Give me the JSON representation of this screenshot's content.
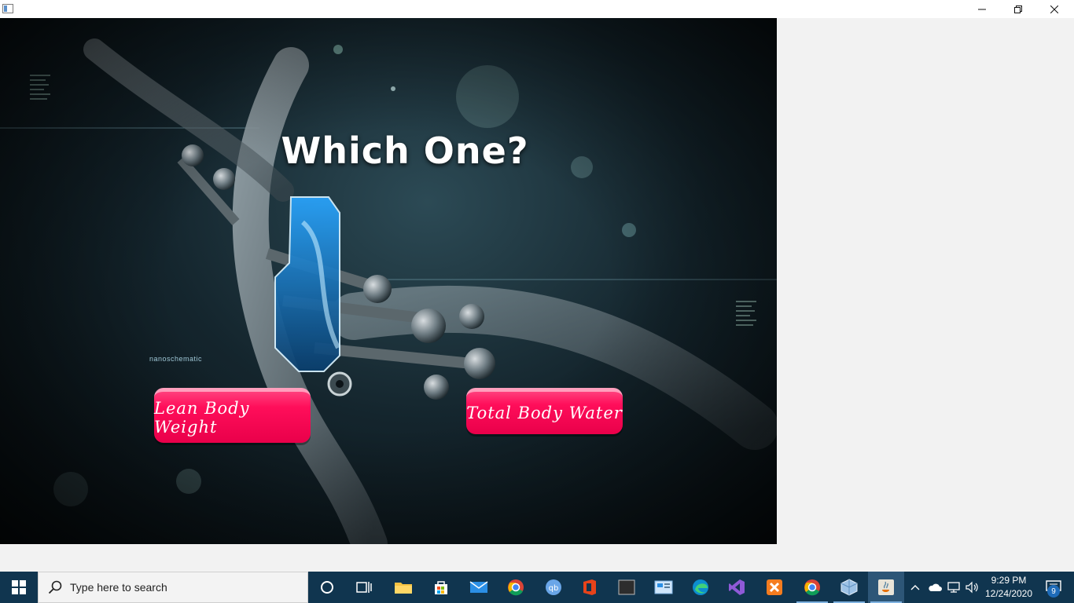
{
  "window": {
    "minimize_label": "",
    "maximize_label": "",
    "close_label": ""
  },
  "screen": {
    "heading": "Which One?",
    "overlay_text": "nanoschematic",
    "options": [
      {
        "label": "Lean Body Weight"
      },
      {
        "label": "Total Body Water"
      }
    ]
  },
  "taskbar": {
    "search_placeholder": "Type here to search",
    "pinned": [
      "task-view-icon",
      "file-explorer-icon",
      "store-icon",
      "mail-icon",
      "chrome-icon",
      "qbittorrent-icon",
      "office-icon",
      "terminal-icon",
      "control-panel-icon",
      "edge-icon",
      "visual-studio-icon",
      "xampp-icon",
      "chrome-icon",
      "virtualbox-icon",
      "java-icon"
    ],
    "time": "9:29 PM",
    "date": "12/24/2020",
    "notification_count": "9"
  },
  "colors": {
    "button_pink": "#ff0e5a",
    "taskbar": "#10354f",
    "window_bg": "#f2f2f2"
  }
}
